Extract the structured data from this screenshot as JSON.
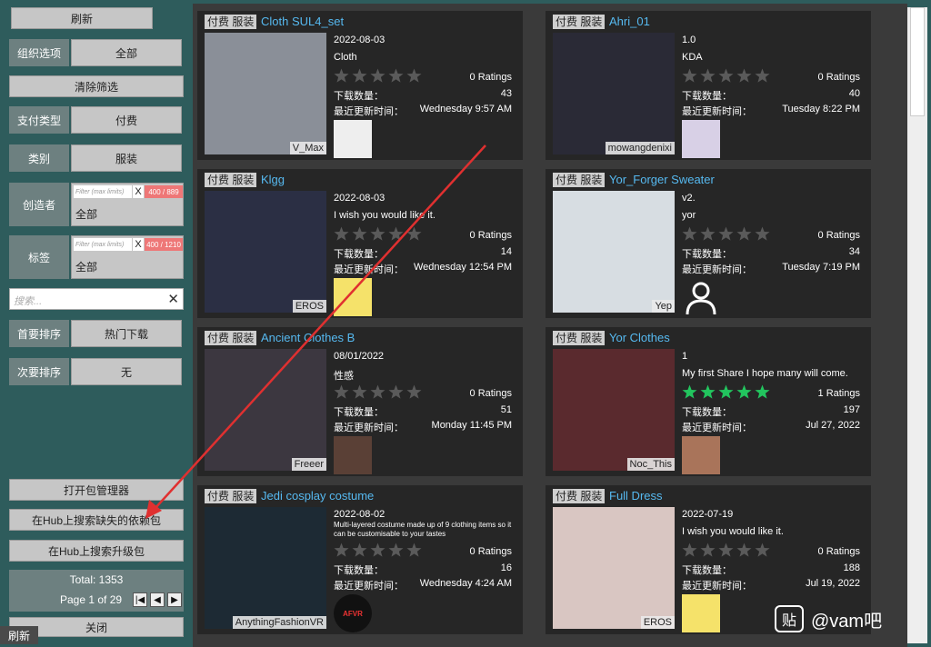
{
  "sidebar": {
    "refresh": "刷新",
    "org_label": "组织选项",
    "org_value": "全部",
    "clear_filters": "清除筛选",
    "pay_label": "支付类型",
    "pay_value": "付费",
    "category_label": "类别",
    "category_value": "服装",
    "creator_label": "创造者",
    "creator_placeholder": "Filter (max limits)",
    "creator_count": "400 / 889",
    "creator_value": "全部",
    "tag_label": "标签",
    "tag_placeholder": "Filter (max limits)",
    "tag_count": "400 / 1210",
    "tag_value": "全部",
    "search_placeholder": "搜索...",
    "primary_sort_label": "首要排序",
    "primary_sort_value": "热门下载",
    "secondary_sort_label": "次要排序",
    "secondary_sort_value": "无",
    "open_pkg_manager": "打开包管理器",
    "search_missing_deps": "在Hub上搜索缺失的依赖包",
    "search_upgrades": "在Hub上搜索升级包",
    "total": "Total: 1353",
    "page": "Page 1 of 29",
    "close": "关闭",
    "refresh_corner": "刷新",
    "clear_x": "X"
  },
  "labels": {
    "downloads": "下载数量：",
    "updated": "最近更新时间："
  },
  "cards": [
    {
      "tag": "付费 服装",
      "title": "Cloth SUL4_set",
      "date": "2022-08-03",
      "desc": "Cloth",
      "stars": 0,
      "ratings": "0 Ratings",
      "downloads": "43",
      "updated": "Wednesday 9:57 AM",
      "user": "V_Max",
      "thumb_color": "#8a8f98",
      "avatar_color": "#eeeeee"
    },
    {
      "tag": "付费 服装",
      "title": "Ahri_01",
      "date": "1.0",
      "desc": "KDA",
      "stars": 0,
      "ratings": "0 Ratings",
      "downloads": "40",
      "updated": "Tuesday 8:22 PM",
      "user": "mowangdenixi",
      "thumb_color": "#2a2a36",
      "avatar_color": "#d8d0e6"
    },
    {
      "tag": "付费 服装",
      "title": "Klgg",
      "date": "2022-08-03",
      "desc": "I wish you would like it.",
      "stars": 0,
      "ratings": "0 Ratings",
      "downloads": "14",
      "updated": "Wednesday 12:54 PM",
      "user": "EROS",
      "thumb_color": "#2b2f44",
      "avatar_color": "#f5e26a"
    },
    {
      "tag": "付费 服装",
      "title": "Yor_Forger Sweater",
      "date": "v2.",
      "desc": "yor",
      "stars": 0,
      "ratings": "0 Ratings",
      "downloads": "34",
      "updated": "Tuesday 7:19 PM",
      "user": "Yep",
      "thumb_color": "#d7dde2",
      "avatar_color": "#262626"
    },
    {
      "tag": "付费 服装",
      "title": "Ancient Clothes B",
      "date": "08/01/2022",
      "desc": "性感",
      "stars": 0,
      "ratings": "0 Ratings",
      "downloads": "51",
      "updated": "Monday 11:45 PM",
      "user": "Freeer",
      "thumb_color": "#3c3740",
      "avatar_color": "#5a4036"
    },
    {
      "tag": "付费 服装",
      "title": "Yor Clothes",
      "date": "1",
      "desc": "My first Share I hope many will come.",
      "stars": 5,
      "ratings": "1 Ratings",
      "downloads": "197",
      "updated": "Jul 27, 2022",
      "user": "Noc_This",
      "thumb_color": "#5a2a2e",
      "avatar_color": "#a9745a"
    },
    {
      "tag": "付费 服装",
      "title": "Jedi cosplay costume",
      "date": "2022-08-02",
      "desc": "Multi-layered costume made up of 9 clothing items so it can be customisable to your tastes",
      "stars": 0,
      "ratings": "0 Ratings",
      "downloads": "16",
      "updated": "Wednesday 4:24 AM",
      "user": "AnythingFashionVR",
      "thumb_color": "#1d2a34",
      "avatar_color": "#111111"
    },
    {
      "tag": "付费 服装",
      "title": "Full Dress",
      "date": "2022-07-19",
      "desc": "I wish you would like it.",
      "stars": 0,
      "ratings": "0 Ratings",
      "downloads": "188",
      "updated": "Jul 19, 2022",
      "user": "EROS",
      "thumb_color": "#d9c6c2",
      "avatar_color": "#f5e26a"
    }
  ],
  "watermark": {
    "icon": "贴",
    "text": "@vam吧"
  },
  "avatar_text": {
    "jedi": "AFVR"
  },
  "colors": {
    "title": "#56b9f0",
    "star_on": "#22c55e",
    "star_off": "#5a5a5a",
    "badge": "#e77777"
  }
}
